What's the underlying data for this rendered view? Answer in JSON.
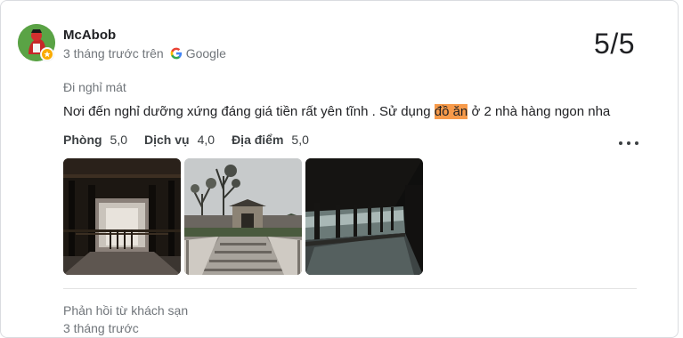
{
  "review": {
    "author": "McAbob",
    "time_ago": "3 tháng trước trên",
    "source": "Google",
    "score": "5/5",
    "trip_type": "Đi nghỉ mát",
    "text_before": "Nơi đến nghỉ dưỡng xứng đáng giá tiền rất yên tĩnh . Sử dụng ",
    "text_highlight": "đồ ăn",
    "text_after": " ở 2 nhà hàng ngon nha",
    "ratings": [
      {
        "label": "Phòng",
        "value": "5,0"
      },
      {
        "label": "Dịch vụ",
        "value": "4,0"
      },
      {
        "label": "Địa điểm",
        "value": "5,0"
      }
    ],
    "photos": [
      "photo-wooden-hall-interior",
      "photo-courtyard-gate",
      "photo-covered-corridor"
    ]
  },
  "reply": {
    "title": "Phản hồi từ khách sạn",
    "time_ago": "3 tháng trước"
  },
  "icons": {
    "google": "google-g-icon",
    "more": "more-options-icon",
    "badge": "local-guide-badge-icon"
  },
  "colors": {
    "highlight": "#f79a4a",
    "text_primary": "#202124",
    "text_secondary": "#70757a"
  }
}
